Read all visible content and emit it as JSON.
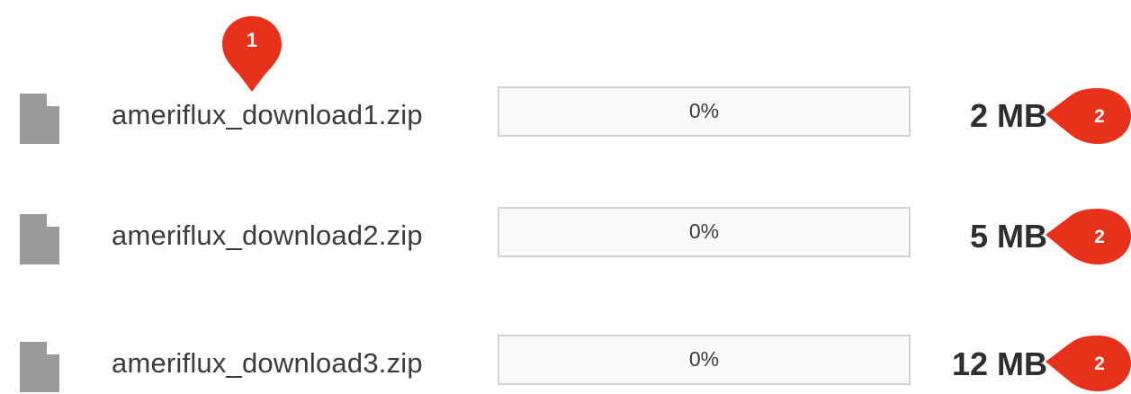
{
  "downloads": [
    {
      "icon": "file-icon",
      "filename": "ameriflux_download1.zip",
      "progress_text": "0%",
      "progress": 0,
      "size": "2 MB"
    },
    {
      "icon": "file-icon",
      "filename": "ameriflux_download2.zip",
      "progress_text": "0%",
      "progress": 0,
      "size": "5 MB"
    },
    {
      "icon": "file-icon",
      "filename": "ameriflux_download3.zip",
      "progress_text": "0%",
      "progress": 0,
      "size": "12 MB"
    }
  ],
  "callouts": {
    "filename_marker": "1",
    "size_marker": "2"
  },
  "colors": {
    "marker": "#e8311b",
    "icon": "#9a9a9a",
    "progress_border": "#d2d2d2"
  }
}
